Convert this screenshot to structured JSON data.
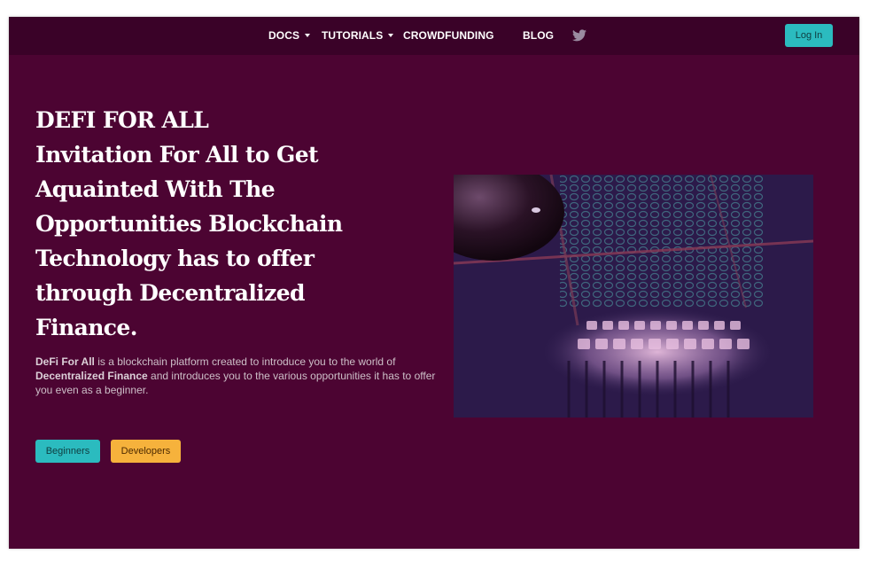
{
  "nav": {
    "items": [
      {
        "label": "DOCS",
        "dropdown": true
      },
      {
        "label": "TUTORIALS",
        "dropdown": true
      },
      {
        "label": "CROWDFUNDING",
        "dropdown": false
      },
      {
        "label": "BLOG",
        "dropdown": false
      }
    ],
    "social_icon": "twitter-icon",
    "login_label": "Log In"
  },
  "hero": {
    "headline": [
      "DEFI FOR ALL",
      "Invitation For All to Get",
      "Aquainted With The",
      "Opportunities Blockchain",
      "Technology has to offer",
      "through Decentralized",
      "Finance."
    ],
    "description": {
      "bold1": "DeFi For All",
      "text1": " is a blockchain platform created to introduce you to the world of ",
      "bold2": "Decentralized Finance",
      "text2": " and introduces you to the various opportunities it has to offer you even as a beginner."
    },
    "buttons": {
      "beginners": "Beginners",
      "developers": "Developers"
    },
    "image": "abstract blockchain illustration"
  },
  "colors": {
    "background": "#4c0432",
    "navbar": "#3a0228",
    "teal": "#2bbbbf",
    "orange": "#f6b23c"
  }
}
